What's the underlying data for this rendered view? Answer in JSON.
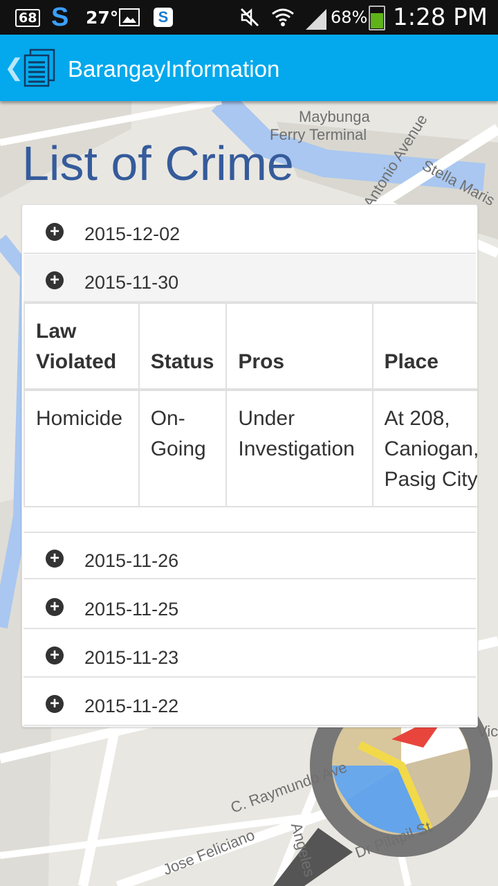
{
  "status_bar": {
    "badge": "68",
    "temperature": "27°",
    "battery_percent": "68%",
    "time": "1:28 PM",
    "icons": [
      "battery-badge-icon",
      "s-app-icon",
      "gallery-icon",
      "skype-icon",
      "mute-icon",
      "wifi-icon",
      "signal-icon",
      "battery-icon"
    ]
  },
  "action_bar": {
    "title": "BarangayInformation",
    "back_icon": "chevron-left-icon",
    "app_icon": "document-list-icon"
  },
  "map_labels": {
    "l1": "Maybunga",
    "l2": "Ferry Terminal",
    "l3": "Antonio Avenue",
    "l4": "Stella Maris",
    "l5": "C. Raymundo Ave",
    "l6": "Jose Feliciano",
    "l7": "Dr Pilapil St",
    "l8": "Angeles",
    "l9": "Victoria"
  },
  "page": {
    "title": "List of Crime"
  },
  "accordion": {
    "items": [
      {
        "date": "2015-12-02",
        "expanded": false
      },
      {
        "date": "2015-11-30",
        "expanded": true
      },
      {
        "date": "2015-11-26",
        "expanded": false
      },
      {
        "date": "2015-11-25",
        "expanded": false
      },
      {
        "date": "2015-11-23",
        "expanded": false
      },
      {
        "date": "2015-11-22",
        "expanded": false
      }
    ],
    "toggle_icon": "plus-circle-icon"
  },
  "crime_table": {
    "headers": [
      "Law Violated",
      "Status",
      "Pros",
      "Place"
    ],
    "rows": [
      [
        "Homicide",
        "On-Going",
        "Under Investigation",
        "At 208, Caniogan, Pasig City"
      ]
    ]
  },
  "colors": {
    "action_bar": "#03a9ec",
    "title": "#355b9b",
    "status_bar": "#111111",
    "battery": "#5fb31a"
  }
}
